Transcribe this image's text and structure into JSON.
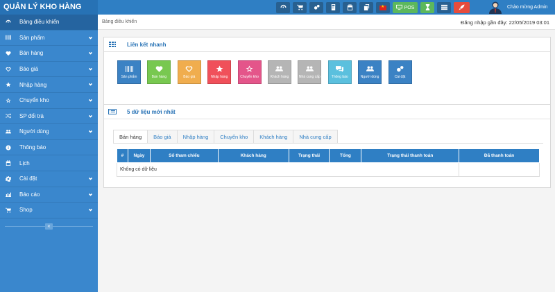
{
  "app": {
    "title": "QUẢN LÝ KHO HÀNG"
  },
  "topbar": {
    "buttons": [
      {
        "icon": "dashboard-icon",
        "color": "#286090"
      },
      {
        "icon": "cart-icon",
        "color": "#286090"
      },
      {
        "icon": "cogs-icon",
        "color": "#286090"
      },
      {
        "icon": "calculator-icon",
        "color": "#286090"
      },
      {
        "icon": "calendar-icon",
        "color": "#286090"
      },
      {
        "icon": "clipboard-icon",
        "color": "#286090"
      },
      {
        "icon": "vietnam-flag-icon",
        "color": "#286090"
      }
    ],
    "pos_label": "POS",
    "pos_color": "#5cb85c",
    "alert_color": "#e74c3c",
    "welcome": "Chào mừng Admin"
  },
  "sidebar": {
    "items": [
      {
        "label": "Bảng điều khiển",
        "icon": "dashboard-icon",
        "active": true,
        "chevron": false
      },
      {
        "label": "Sản phẩm",
        "icon": "barcode-icon",
        "active": false,
        "chevron": true
      },
      {
        "label": "Bán hàng",
        "icon": "heart-icon",
        "active": false,
        "chevron": true
      },
      {
        "label": "Báo giá",
        "icon": "heart-outline-icon",
        "active": false,
        "chevron": true
      },
      {
        "label": "Nhập hàng",
        "icon": "star-icon",
        "active": false,
        "chevron": true
      },
      {
        "label": "Chuyển kho",
        "icon": "star-outline-icon",
        "active": false,
        "chevron": true
      },
      {
        "label": "SP đổi trả",
        "icon": "shuffle-icon",
        "active": false,
        "chevron": true
      },
      {
        "label": "Người dùng",
        "icon": "users-icon",
        "active": false,
        "chevron": true
      },
      {
        "label": "Thông báo",
        "icon": "info-icon",
        "active": false,
        "chevron": false
      },
      {
        "label": "Lịch",
        "icon": "calendar-icon",
        "active": false,
        "chevron": false
      },
      {
        "label": "Cài đặt",
        "icon": "cog-icon",
        "active": false,
        "chevron": true
      },
      {
        "label": "Báo cáo",
        "icon": "bar-chart-icon",
        "active": false,
        "chevron": true
      },
      {
        "label": "Shop",
        "icon": "cart-icon",
        "active": false,
        "chevron": true
      }
    ],
    "collapse_label": "«"
  },
  "main": {
    "breadcrumb": "Bảng điều khiển",
    "last_login": "Đăng nhập gần đây: 22/05/2019 03:01",
    "quick_links": {
      "title": "Liên kết nhanh",
      "items": [
        {
          "label": "Sản phẩm",
          "icon": "barcode-icon",
          "color": "#3b82c4"
        },
        {
          "label": "Bán hàng",
          "icon": "heart-icon",
          "color": "#78c850"
        },
        {
          "label": "Báo giá",
          "icon": "heart-outline-icon",
          "color": "#f0ad4e"
        },
        {
          "label": "Nhập hàng",
          "icon": "star-icon",
          "color": "#f0505a"
        },
        {
          "label": "Chuyển kho",
          "icon": "star-outline-icon",
          "color": "#e4558a"
        },
        {
          "label": "Khách hàng",
          "icon": "users-icon",
          "color": "#b5b5b5"
        },
        {
          "label": "Nhà cung cấp",
          "icon": "users-icon",
          "color": "#b5b5b5"
        },
        {
          "label": "Thông báo",
          "icon": "comments-icon",
          "color": "#5bc0de"
        },
        {
          "label": "Người dùng",
          "icon": "users-icon",
          "color": "#3b82c4"
        },
        {
          "label": "Cài đặt",
          "icon": "cogs-icon",
          "color": "#3b82c4"
        }
      ]
    },
    "latest": {
      "title": "5 dữ liệu mới nhất",
      "tabs": [
        "Bán hàng",
        "Báo giá",
        "Nhập hàng",
        "Chuyển kho",
        "Khách hàng",
        "Nhà cung cấp"
      ],
      "columns": [
        "#",
        "Ngày",
        "Số tham chiếu",
        "Khách hàng",
        "Trạng thái",
        "Tổng",
        "Trạng thái thanh toán",
        "Đã thanh toán"
      ],
      "empty": "Không có dữ liệu"
    }
  }
}
